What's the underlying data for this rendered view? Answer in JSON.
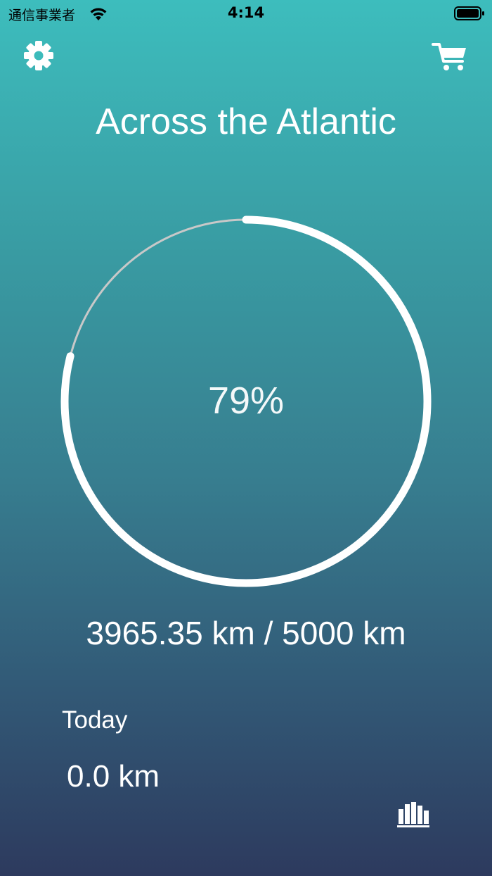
{
  "status_bar": {
    "carrier": "通信事業者",
    "time": "4:14"
  },
  "header": {
    "title": "Across the Atlantic"
  },
  "progress": {
    "percent_label": "79%",
    "fraction": 0.79,
    "distance_label": "3965.35 km / 5000 km"
  },
  "today": {
    "label": "Today",
    "value": "0.0 km"
  },
  "icons": {
    "settings": "gear-icon",
    "cart": "cart-icon",
    "stats": "bar-chart-icon"
  },
  "colors": {
    "gradient_top": "#3dbdbd",
    "gradient_bottom": "#2d3a5e",
    "ring_fill": "#ffffff",
    "ring_track": "#c8c8c8"
  }
}
